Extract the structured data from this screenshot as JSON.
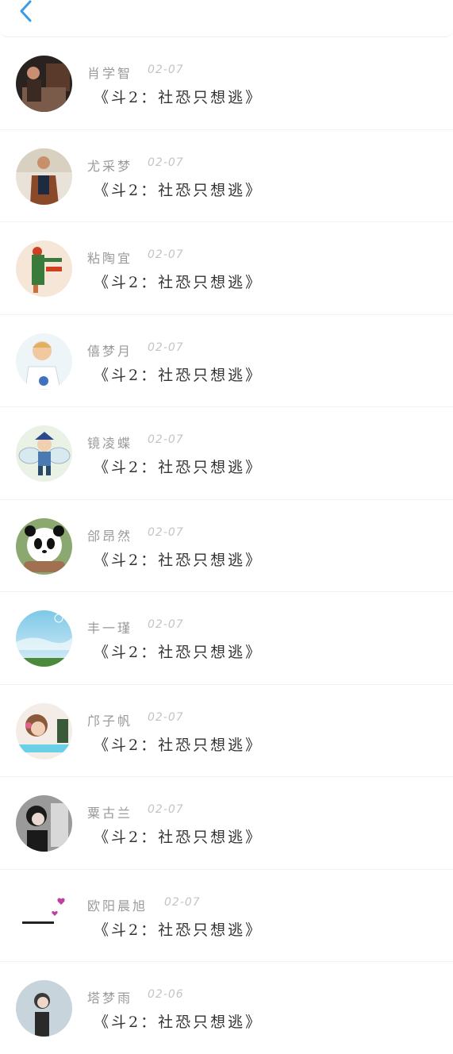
{
  "header": {
    "back_icon": "chevron-left-icon"
  },
  "colors": {
    "accent": "#3a9ce6",
    "name": "#9a9a9a",
    "date": "#c4c4c4",
    "message": "#333333"
  },
  "comments": [
    {
      "name": "肖学智",
      "date": "02-07",
      "message": "《斗2：社恐只想逃》"
    },
    {
      "name": "尤采梦",
      "date": "02-07",
      "message": "《斗2：社恐只想逃》"
    },
    {
      "name": "粘陶宜",
      "date": "02-07",
      "message": "《斗2：社恐只想逃》"
    },
    {
      "name": "僖梦月",
      "date": "02-07",
      "message": "《斗2：社恐只想逃》"
    },
    {
      "name": "镜凌蝶",
      "date": "02-07",
      "message": "《斗2：社恐只想逃》"
    },
    {
      "name": "郃昂然",
      "date": "02-07",
      "message": "《斗2：社恐只想逃》"
    },
    {
      "name": "丰一瑾",
      "date": "02-07",
      "message": "《斗2：社恐只想逃》"
    },
    {
      "name": "邝子帆",
      "date": "02-07",
      "message": "《斗2：社恐只想逃》"
    },
    {
      "name": "粟古兰",
      "date": "02-07",
      "message": "《斗2：社恐只想逃》"
    },
    {
      "name": "欧阳晨旭",
      "date": "02-07",
      "message": "《斗2：社恐只想逃》"
    },
    {
      "name": "塔梦雨",
      "date": "02-06",
      "message": "《斗2：社恐只想逃》"
    }
  ]
}
